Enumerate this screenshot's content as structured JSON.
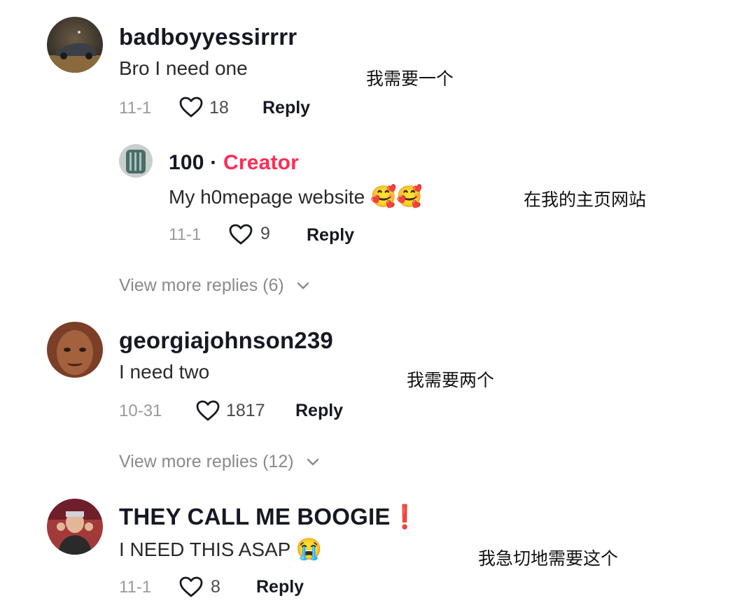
{
  "comments": [
    {
      "username": "badboyyessirrrr",
      "text": "Bro I need one",
      "translation": "我需要一个",
      "date": "11-1",
      "likes": "18",
      "reply_label": "Reply",
      "replies": [
        {
          "username": "100",
          "separator": "·",
          "badge": "Creator",
          "text": "My h0mepage website",
          "emoji": "🥰🥰",
          "translation": "在我的主页网站",
          "date": "11-1",
          "likes": "9",
          "reply_label": "Reply"
        }
      ],
      "view_more": "View more replies (6)"
    },
    {
      "username": "georgiajohnson239",
      "text": "I need two",
      "translation": "我需要两个",
      "date": "10-31",
      "likes": "1817",
      "reply_label": "Reply",
      "view_more": "View more replies (12)"
    },
    {
      "username": "THEY CALL ME BOOGIE",
      "username_emoji": "❗",
      "text": "I NEED THIS ASAP",
      "emoji": "😭",
      "translation": "我急切地需要这个",
      "date": "11-1",
      "likes": "8",
      "reply_label": "Reply"
    }
  ],
  "icons": {
    "like": "heart-outline-icon",
    "expand": "chevron-down-icon"
  },
  "colors": {
    "creator_badge": "#fe2c55",
    "meta_gray": "#9a9a9a"
  }
}
